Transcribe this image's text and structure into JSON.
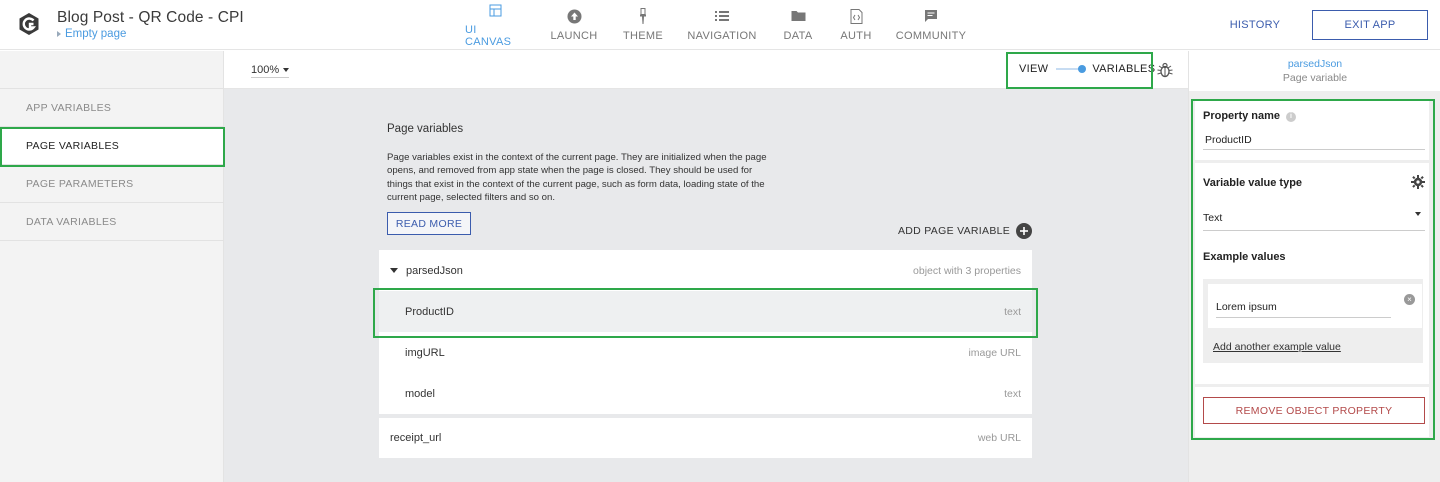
{
  "header": {
    "title": "Blog Post - QR Code - CPI",
    "page": "Empty page",
    "history_label": "HISTORY",
    "exit_label": "EXIT APP"
  },
  "nav": [
    {
      "label": "UI CANVAS",
      "icon": "canvas-icon"
    },
    {
      "label": "LAUNCH",
      "icon": "launch-icon"
    },
    {
      "label": "THEME",
      "icon": "brush-icon"
    },
    {
      "label": "NAVIGATION",
      "icon": "list-icon"
    },
    {
      "label": "DATA",
      "icon": "folder-icon"
    },
    {
      "label": "AUTH",
      "icon": "code-file-icon"
    },
    {
      "label": "COMMUNITY",
      "icon": "chat-icon"
    }
  ],
  "sidebar": {
    "items": [
      {
        "label": "APP VARIABLES"
      },
      {
        "label": "PAGE VARIABLES"
      },
      {
        "label": "PAGE PARAMETERS"
      },
      {
        "label": "DATA VARIABLES"
      }
    ]
  },
  "toolbar": {
    "zoom": "100%",
    "view_label": "VIEW",
    "variables_label": "VARIABLES"
  },
  "main": {
    "title": "Page variables",
    "description": "Page variables exist in the context of the current page. They are initialized when the page opens, and removed from app state when the page is closed. They should be used for things that exist in the context of the current page, such as form data, loading state of the current page, selected filters and so on.",
    "read_more": "READ MORE",
    "add_variable": "ADD PAGE VARIABLE",
    "variables": [
      {
        "name": "parsedJson",
        "type": "object with 3 properties"
      },
      {
        "name": "ProductID",
        "type": "text"
      },
      {
        "name": "imgURL",
        "type": "image URL"
      },
      {
        "name": "model",
        "type": "text"
      },
      {
        "name": "receipt_url",
        "type": "web URL"
      }
    ]
  },
  "panel": {
    "parent_name": "parsedJson",
    "parent_type": "Page variable",
    "property_name_label": "Property name",
    "property_name_value": "ProductID",
    "value_type_label": "Variable value type",
    "value_type_value": "Text",
    "example_values_label": "Example values",
    "example_value": "Lorem ipsum",
    "add_example": "Add another example value",
    "remove_label": "REMOVE OBJECT PROPERTY"
  },
  "colors": {
    "accent": "#4a9be0",
    "primary": "#3b5cad",
    "danger": "#b34a4a",
    "highlight": "#2ea84a"
  }
}
